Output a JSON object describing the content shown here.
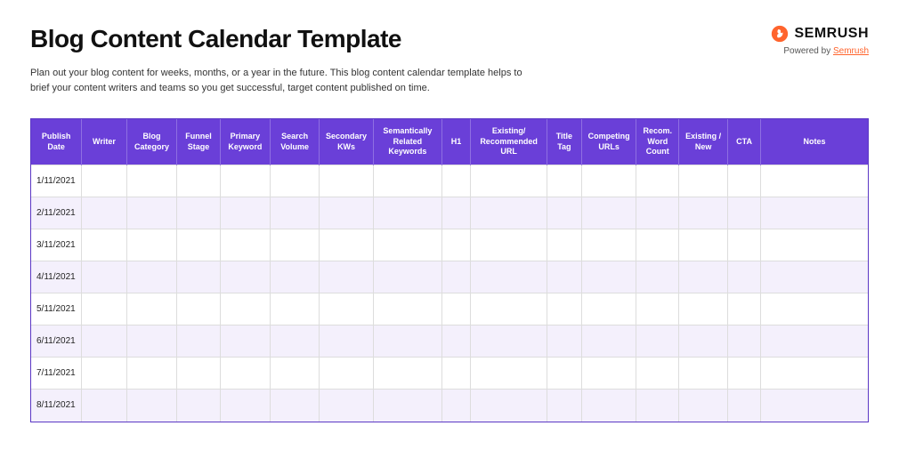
{
  "header": {
    "title": "Blog Content Calendar Template",
    "subtitle": "Plan out your blog content for weeks, months, or a year in the future. This blog content calendar template helps to brief your content writers and teams so you get successful, target content published on time."
  },
  "brand": {
    "name": "SEMRUSH",
    "powered_label": "Powered by ",
    "powered_link": "Semrush"
  },
  "table": {
    "columns": [
      "Publish Date",
      "Writer",
      "Blog Category",
      "Funnel Stage",
      "Primary Keyword",
      "Search Volume",
      "Secondary KWs",
      "Semantically Related Keywords",
      "H1",
      "Existing/ Recommended URL",
      "Title Tag",
      "Competing URLs",
      "Recom. Word Count",
      "Existing / New",
      "CTA",
      "Notes"
    ],
    "rows": [
      {
        "publish_date": "1/11/2021",
        "writer": "",
        "blog_category": "",
        "funnel_stage": "",
        "primary_keyword": "",
        "search_volume": "",
        "secondary_kws": "",
        "semantic_keywords": "",
        "h1": "",
        "url": "",
        "title_tag": "",
        "competing_urls": "",
        "word_count": "",
        "existing_new": "",
        "cta": "",
        "notes": ""
      },
      {
        "publish_date": "2/11/2021",
        "writer": "",
        "blog_category": "",
        "funnel_stage": "",
        "primary_keyword": "",
        "search_volume": "",
        "secondary_kws": "",
        "semantic_keywords": "",
        "h1": "",
        "url": "",
        "title_tag": "",
        "competing_urls": "",
        "word_count": "",
        "existing_new": "",
        "cta": "",
        "notes": ""
      },
      {
        "publish_date": "3/11/2021",
        "writer": "",
        "blog_category": "",
        "funnel_stage": "",
        "primary_keyword": "",
        "search_volume": "",
        "secondary_kws": "",
        "semantic_keywords": "",
        "h1": "",
        "url": "",
        "title_tag": "",
        "competing_urls": "",
        "word_count": "",
        "existing_new": "",
        "cta": "",
        "notes": ""
      },
      {
        "publish_date": "4/11/2021",
        "writer": "",
        "blog_category": "",
        "funnel_stage": "",
        "primary_keyword": "",
        "search_volume": "",
        "secondary_kws": "",
        "semantic_keywords": "",
        "h1": "",
        "url": "",
        "title_tag": "",
        "competing_urls": "",
        "word_count": "",
        "existing_new": "",
        "cta": "",
        "notes": ""
      },
      {
        "publish_date": "5/11/2021",
        "writer": "",
        "blog_category": "",
        "funnel_stage": "",
        "primary_keyword": "",
        "search_volume": "",
        "secondary_kws": "",
        "semantic_keywords": "",
        "h1": "",
        "url": "",
        "title_tag": "",
        "competing_urls": "",
        "word_count": "",
        "existing_new": "",
        "cta": "",
        "notes": ""
      },
      {
        "publish_date": "6/11/2021",
        "writer": "",
        "blog_category": "",
        "funnel_stage": "",
        "primary_keyword": "",
        "search_volume": "",
        "secondary_kws": "",
        "semantic_keywords": "",
        "h1": "",
        "url": "",
        "title_tag": "",
        "competing_urls": "",
        "word_count": "",
        "existing_new": "",
        "cta": "",
        "notes": ""
      },
      {
        "publish_date": "7/11/2021",
        "writer": "",
        "blog_category": "",
        "funnel_stage": "",
        "primary_keyword": "",
        "search_volume": "",
        "secondary_kws": "",
        "semantic_keywords": "",
        "h1": "",
        "url": "",
        "title_tag": "",
        "competing_urls": "",
        "word_count": "",
        "existing_new": "",
        "cta": "",
        "notes": ""
      },
      {
        "publish_date": "8/11/2021",
        "writer": "",
        "blog_category": "",
        "funnel_stage": "",
        "primary_keyword": "",
        "search_volume": "",
        "secondary_kws": "",
        "semantic_keywords": "",
        "h1": "",
        "url": "",
        "title_tag": "",
        "competing_urls": "",
        "word_count": "",
        "existing_new": "",
        "cta": "",
        "notes": ""
      }
    ]
  }
}
